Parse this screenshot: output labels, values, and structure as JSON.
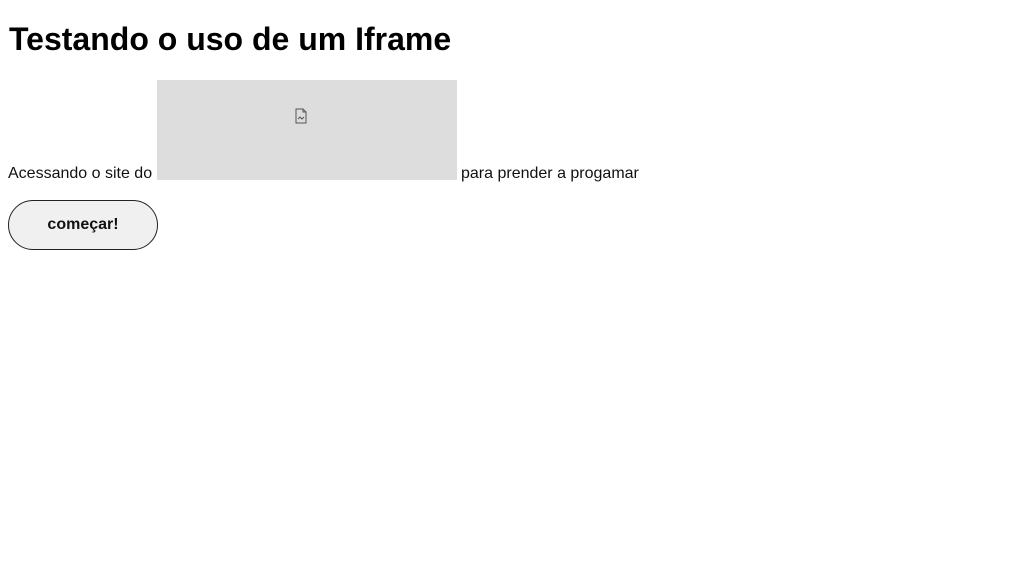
{
  "page": {
    "title": "Testando o uso de um Iframe"
  },
  "content": {
    "text_before_iframe": "Acessando o site do",
    "text_after_iframe": "para prender a progamar",
    "iframe_icon": "broken-document-icon"
  },
  "actions": {
    "start_button_label": "começar!"
  },
  "colors": {
    "iframe_placeholder_bg": "#dddddd",
    "button_bg": "#f0f0f0",
    "button_border": "#222222"
  }
}
